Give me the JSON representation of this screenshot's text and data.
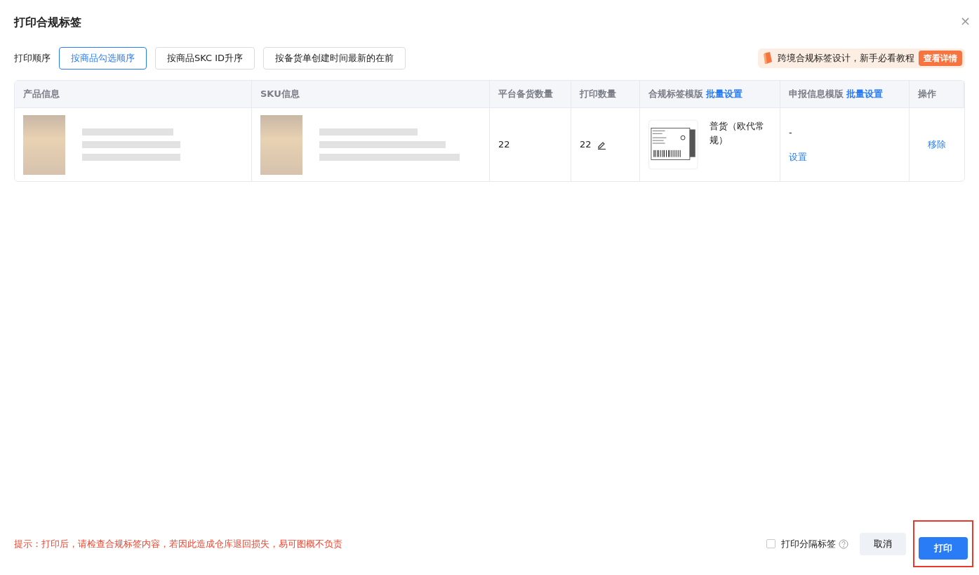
{
  "dialog": {
    "title": "打印合规标签",
    "close": "×"
  },
  "order": {
    "label": "打印顺序",
    "options": [
      {
        "label": "按商品勾选顺序",
        "selected": true
      },
      {
        "label": "按商品SKC ID升序",
        "selected": false
      },
      {
        "label": "按备货单创建时间最新的在前",
        "selected": false
      }
    ]
  },
  "tutorial_banner": {
    "text": "跨境合规标签设计，新手必看教程",
    "button": "查看详情"
  },
  "table": {
    "columns": [
      {
        "label": "产品信息"
      },
      {
        "label": "SKU信息"
      },
      {
        "label": "平台备货数量"
      },
      {
        "label": "打印数量"
      },
      {
        "label": "合规标签模版",
        "link": "批量设置"
      },
      {
        "label": "申报信息模版",
        "link": "批量设置"
      },
      {
        "label": "操作"
      }
    ],
    "rows": [
      {
        "platform_qty": "22",
        "print_qty": "22",
        "label_template": "普货（欧代常规）",
        "declare_template": "-",
        "declare_link": "设置",
        "action": "移除"
      }
    ]
  },
  "footer": {
    "notice": "提示：打印后，请检查合规标签内容，若因此造成仓库退回损失，易可图概不负责",
    "separator_label": {
      "label": "打印分隔标签",
      "checked": false
    },
    "cancel": "取消",
    "print": {
      "label": "打印",
      "highlighted": true
    }
  }
}
